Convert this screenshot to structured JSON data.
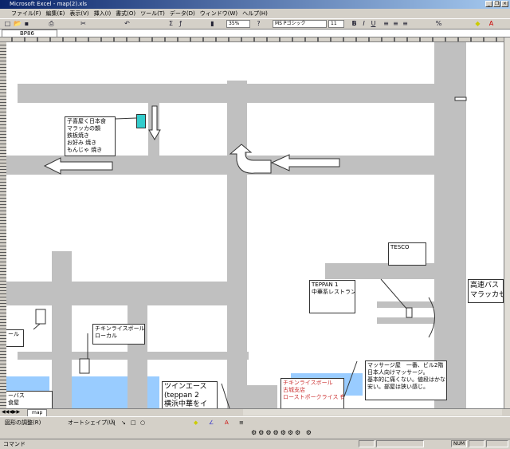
{
  "window": {
    "title": "Microsoft Excel - map(2).xls",
    "app_icon": "excel-icon"
  },
  "menu": [
    "ファイル(F)",
    "編集(E)",
    "表示(V)",
    "挿入(I)",
    "書式(O)",
    "ツール(T)",
    "データ(D)",
    "ウィンドウ(W)",
    "ヘルプ(H)"
  ],
  "toolbar": {
    "zoom": "35%",
    "font": "MS Pゴシック",
    "size": "11",
    "bold": "B",
    "italic": "I",
    "underline": "U",
    "percent": "%"
  },
  "formula": {
    "name_box": "BP86",
    "value": ""
  },
  "notes": {
    "okonomi": [
      "子喜屋く日本食",
      "マラッカの韻",
      "鉄板焼き",
      "お好み 焼き",
      "もんじゃ 焼き"
    ],
    "tesco": [
      "TESCO"
    ],
    "teppan1": [
      "TEPPAN 1",
      "中華系レストラン"
    ],
    "bus": [
      "高速バス",
      "マラッカセ"
    ],
    "chicken_local": [
      "チキンライスボール",
      "ローカル"
    ],
    "left_edge": [
      "ール"
    ],
    "bus_left": [
      "ーバス",
      "食屋"
    ],
    "twin": [
      "ツインエース",
      "(teppan 2",
      "横浜中華をイ"
    ],
    "chicken_red": [
      "チキンライスボール",
      "古城支店",
      "ローストポークライス 有"
    ],
    "massage": [
      "マッサージ屋　一番、ビル2階",
      "日本人向けマッサージ。",
      "基本的に痛くない。値段はかなり",
      "安い。部屋は狭い感じ。"
    ]
  },
  "colors": {
    "road": "#c0c0c0",
    "water": "#99ccff",
    "marker": "#33cccc",
    "red_text": "#cc3333"
  },
  "sheet_tab": "map",
  "draw_toolbar": {
    "draw": "図形の調整(R)",
    "autoshape": "オートシェイプ(U)"
  },
  "status": {
    "mode": "コマンド",
    "num": "NUM"
  }
}
